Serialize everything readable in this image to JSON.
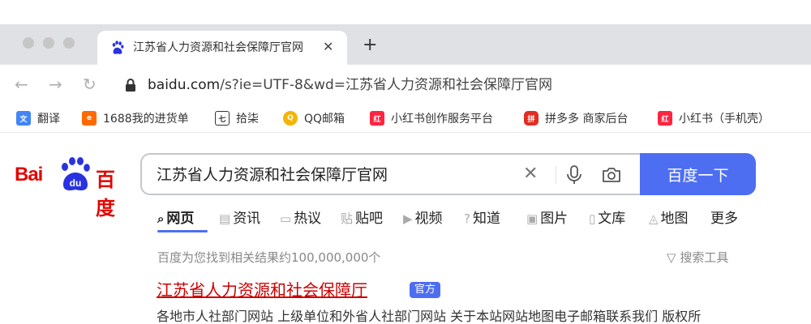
{
  "browser": {
    "tab": {
      "title": "江苏省人力资源和社会保障厅官网",
      "favicon": "baidu-paw-icon"
    },
    "url_host": "baidu.com",
    "url_path": "/s?ie=UTF-8&wd=江苏省人力资源和社会保障厅官网",
    "bookmarks": [
      {
        "label": "翻译",
        "icon": "translate-icon",
        "color": "#4285f4"
      },
      {
        "label": "1688我的进货单",
        "icon": "1688-icon",
        "color": "#ff6a00"
      },
      {
        "label": "拾柒",
        "icon": "shiqi-icon",
        "color": "#333333"
      },
      {
        "label": "QQ邮箱",
        "icon": "qqmail-icon",
        "color": "#f4b400"
      },
      {
        "label": "小红书创作服务平台",
        "icon": "xiaohongshu-icon",
        "color": "#ff2442"
      },
      {
        "label": "拼多多 商家后台",
        "icon": "pinduoduo-icon",
        "color": "#e02e24"
      },
      {
        "label": "小红书（手机壳）",
        "icon": "xiaohongshu-icon",
        "color": "#ff2442"
      }
    ]
  },
  "search": {
    "logo_bai": "Bai",
    "logo_du": "du",
    "logo_cn": "百度",
    "query": "江苏省人力资源和社会保障厅官网",
    "button": "百度一下",
    "tabs": [
      {
        "label": "网页",
        "icon": "search-icon"
      },
      {
        "label": "资讯",
        "icon": "news-icon"
      },
      {
        "label": "热议",
        "icon": "discussion-icon"
      },
      {
        "label": "贴吧",
        "icon": "tieba-icon"
      },
      {
        "label": "视频",
        "icon": "video-icon"
      },
      {
        "label": "知道",
        "icon": "question-icon"
      },
      {
        "label": "图片",
        "icon": "image-icon"
      },
      {
        "label": "文库",
        "icon": "document-icon"
      },
      {
        "label": "地图",
        "icon": "map-icon"
      },
      {
        "label": "更多",
        "icon": ""
      }
    ],
    "result_count": "百度为您找到相关结果约100,000,000个",
    "tools_label": "搜索工具"
  },
  "result": {
    "title": "江苏省人力资源和社会保障厅",
    "badge": "官方",
    "sublinks": "各地市人社部门网站 上级单位和外省人社部门网站 关于本站网站地图电子邮箱联系我们 版权所"
  },
  "colors": {
    "accent": "#4e6ef2",
    "brand_red": "#e10602",
    "result_title": "#cc0000"
  }
}
